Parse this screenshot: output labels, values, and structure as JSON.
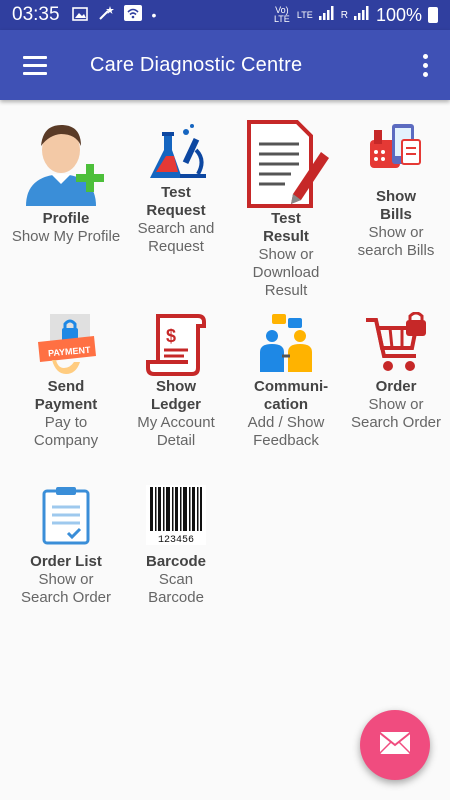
{
  "statusbar": {
    "time": "03:35",
    "battery": "100%",
    "network_1": "Vo) LTE",
    "network_2": "LTE",
    "roaming": "R"
  },
  "appbar": {
    "title": "Care Diagnostic Centre"
  },
  "tiles": [
    {
      "icon": "profile-icon",
      "title": "Profile",
      "sub": "Show My Profile"
    },
    {
      "icon": "test-request-icon",
      "title": "Test Request",
      "sub": "Search and Request"
    },
    {
      "icon": "test-result-icon",
      "title": "Test Result",
      "sub": "Show or Download Result"
    },
    {
      "icon": "bills-icon",
      "title": "Show Bills",
      "sub": "Show or search Bills"
    },
    {
      "icon": "payment-icon",
      "title": "Send Payment",
      "sub": "Pay to Company",
      "badge": "PAYMENT"
    },
    {
      "icon": "ledger-icon",
      "title": "Show Ledger",
      "sub": "My Account Detail"
    },
    {
      "icon": "communication-icon",
      "title": "Communi-cation",
      "sub": "Add / Show Feedback"
    },
    {
      "icon": "order-cart-icon",
      "title": "Order",
      "sub": "Show or Search Order"
    },
    {
      "icon": "order-list-icon",
      "title": "Order List",
      "sub": "Show or Search Order"
    },
    {
      "icon": "barcode-icon",
      "title": "Barcode",
      "sub": "Scan Barcode",
      "barcode_number": "123456"
    }
  ],
  "colors": {
    "statusbar": "#303f9f",
    "appbar": "#3f51b5",
    "fab": "#f04c7f"
  },
  "fab": {
    "icon": "mail-icon"
  }
}
